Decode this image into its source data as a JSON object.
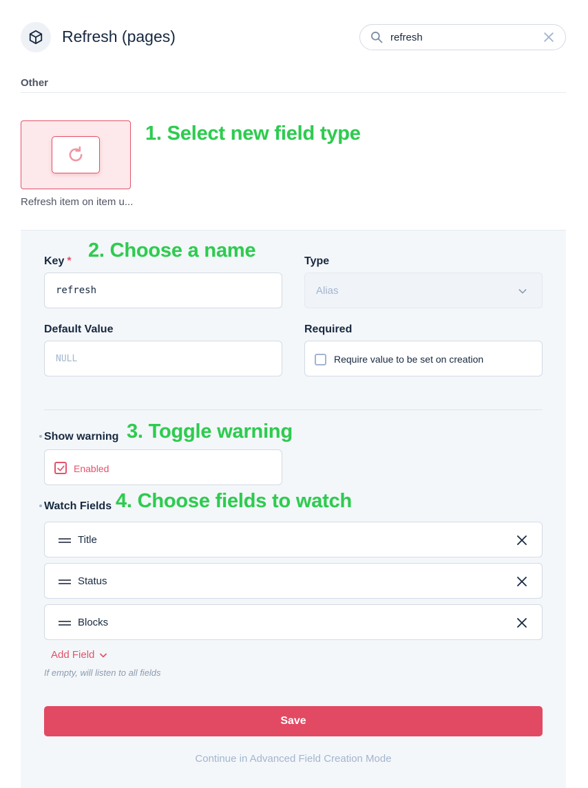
{
  "header": {
    "title": "Refresh (pages)",
    "icon": "cube-icon"
  },
  "search": {
    "value": "refresh",
    "icon": "search-icon",
    "clear_icon": "close-icon"
  },
  "section": {
    "label": "Other"
  },
  "field_type": {
    "caption": "Refresh item on item u...",
    "icon": "refresh-icon"
  },
  "annotations": {
    "step1": "1. Select new field type",
    "step2": "2.  Choose a name",
    "step3": "3. Toggle warning",
    "step4": "4. Choose fields to watch"
  },
  "form": {
    "key_label": "Key",
    "key_required_marker": "*",
    "key_value": "refresh",
    "type_label": "Type",
    "type_value": "Alias",
    "default_label": "Default Value",
    "default_placeholder": "NULL",
    "required_label": "Required",
    "required_checkbox_label": "Require value to be set on creation",
    "required_checked": false
  },
  "warning": {
    "label": "Show warning",
    "toggle_label": "Enabled",
    "checked": true
  },
  "watch_fields": {
    "label": "Watch Fields",
    "items": [
      "Title",
      "Status",
      "Blocks"
    ],
    "add_label": "Add Field",
    "hint": "If empty, will listen to all fields"
  },
  "actions": {
    "save_label": "Save",
    "advanced_label": "Continue in Advanced Field Creation Mode"
  },
  "colors": {
    "accent": "#e35169",
    "annotation": "#2ecb4f",
    "panel_bg": "#f4f7fa"
  }
}
